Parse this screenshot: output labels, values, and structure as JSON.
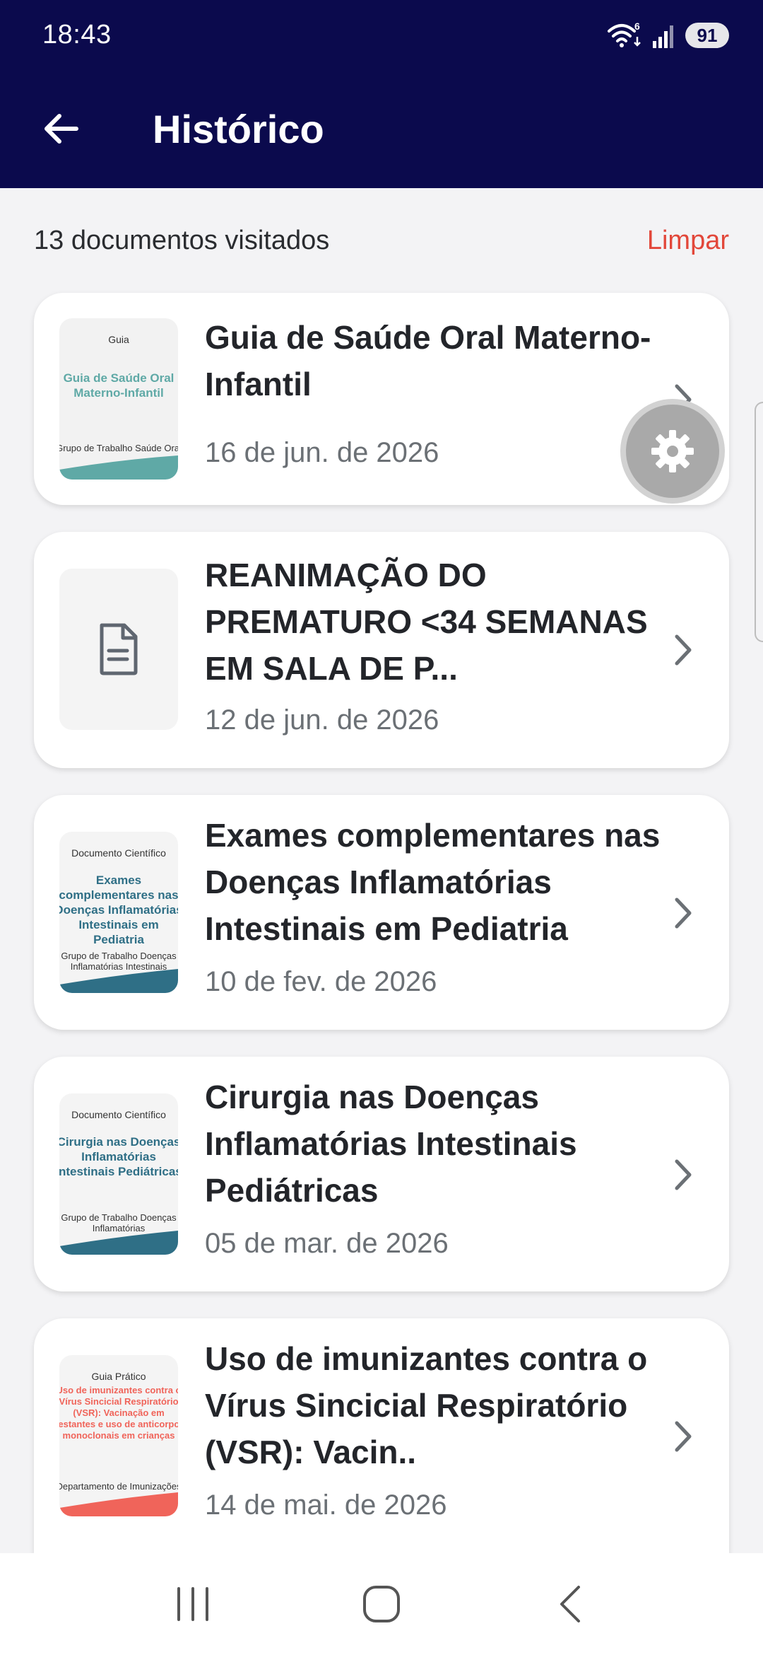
{
  "status_bar": {
    "time": "18:43",
    "wifi_badge": "6",
    "battery": "91"
  },
  "header": {
    "title": "Histórico"
  },
  "summary": {
    "count_text": "13 documentos visitados",
    "clear_label": "Limpar"
  },
  "documents": [
    {
      "title": "Guia de Saúde Oral Materno-Infantil",
      "date": "16 de jun. de 2026",
      "thumb": {
        "label": "Guia",
        "title": "Guia de Saúde Oral Materno-Infantil",
        "footer": "Grupo de Trabalho Saúde Oral",
        "color": "#5fa9a6"
      }
    },
    {
      "title": "REANIMAÇÃO DO PREMATURO <34 SEMANAS EM SALA DE P...",
      "date": "12 de jun. de 2026",
      "thumb": {
        "icon": "document-icon"
      }
    },
    {
      "title": "Exames complementares nas Doenças Inflamatórias Intestinais em Pediatria",
      "date": "10 de fev. de 2026",
      "thumb": {
        "label": "Documento Científico",
        "title": "Exames complementares nas Doenças Inflamatórias Intestinais em Pediatria",
        "footer": "Grupo de Trabalho Doenças Inflamatórias Intestinais",
        "color": "#2f6f86"
      }
    },
    {
      "title": "Cirurgia nas Doenças Inflamatórias Intestinais Pediátricas",
      "date": "05 de mar. de 2026",
      "thumb": {
        "label": "Documento Científico",
        "title": "Cirurgia nas Doenças Inflamatórias Intestinais Pediátricas",
        "footer": "Grupo de Trabalho Doenças Inflamatórias",
        "color": "#2f6f86"
      }
    },
    {
      "title": "Uso de imunizantes contra o Vírus Sincicial Respiratório (VSR): Vacin..",
      "date": "14 de mai. de 2026",
      "thumb": {
        "label": "Guia Prático",
        "title": "Uso de imunizantes contra o Vírus Sincicial Respiratório (VSR): Vacinação em gestantes e uso de anticorpos monoclonais em crianças",
        "footer": "Departamento de Imunizações",
        "color": "#f0645a"
      }
    }
  ],
  "icons": {
    "back": "arrow-left-icon",
    "settings": "gear-icon",
    "chevron": "chevron-right-icon"
  },
  "colors": {
    "header_bg": "#0b0a4d",
    "accent_clear": "#e2473a"
  }
}
